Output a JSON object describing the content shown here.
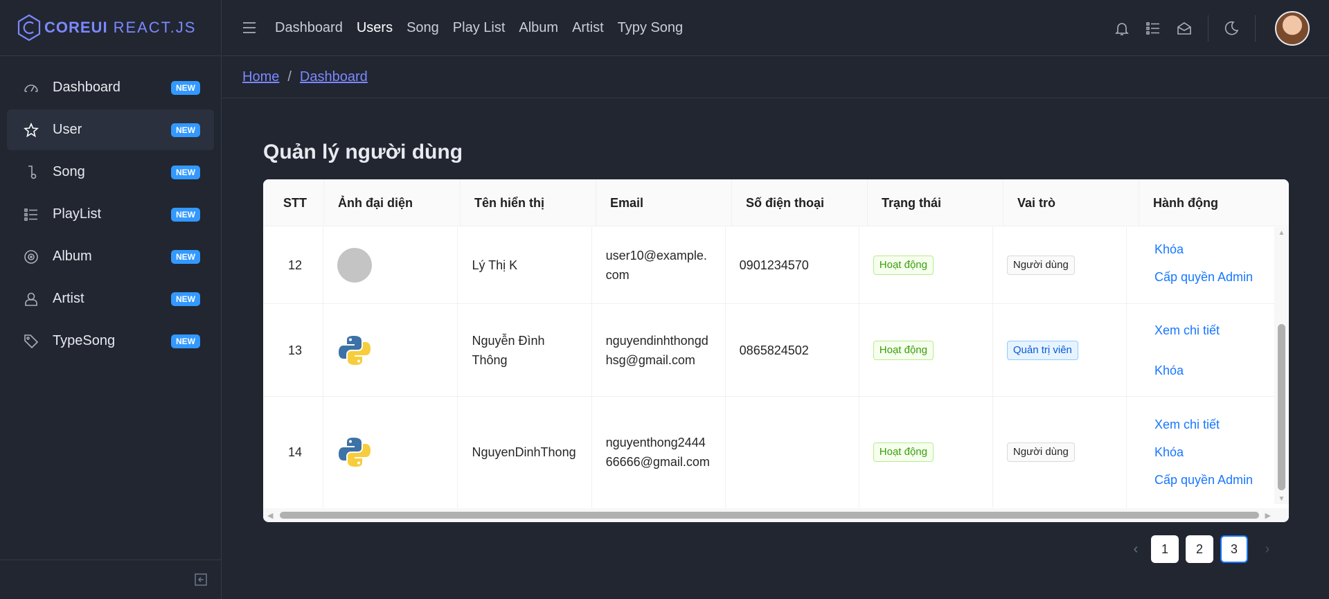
{
  "brand": {
    "core": "COREUI",
    "react": "REACT.JS"
  },
  "sidebar": {
    "items": [
      {
        "label": "Dashboard",
        "badge": "NEW",
        "icon": "speedometer-icon"
      },
      {
        "label": "User",
        "badge": "NEW",
        "icon": "star-icon"
      },
      {
        "label": "Song",
        "badge": "NEW",
        "icon": "music-note-icon"
      },
      {
        "label": "PlayList",
        "badge": "NEW",
        "icon": "list-icon"
      },
      {
        "label": "Album",
        "badge": "NEW",
        "icon": "disc-icon"
      },
      {
        "label": "Artist",
        "badge": "NEW",
        "icon": "user-icon"
      },
      {
        "label": "TypeSong",
        "badge": "NEW",
        "icon": "tag-icon"
      }
    ]
  },
  "header": {
    "nav": [
      "Dashboard",
      "Users",
      "Song",
      "Play List",
      "Album",
      "Artist",
      "Typy Song"
    ],
    "active": "Users"
  },
  "breadcrumb": {
    "home": "Home",
    "current": "Dashboard",
    "separator": "/"
  },
  "page": {
    "title": "Quản lý người dùng"
  },
  "table": {
    "columns": [
      "STT",
      "Ảnh đại diện",
      "Tên hiển thị",
      "Email",
      "Số điện thoại",
      "Trạng thái",
      "Vai trò",
      "Hành động"
    ],
    "rows": [
      {
        "stt": "12",
        "avatar": "placeholder",
        "name": "Lý Thị K",
        "email": "user10@example.com",
        "phone": "0901234570",
        "status": "Hoạt động",
        "role": "Người dùng",
        "actions": [
          "Khóa",
          "Cấp quyền Admin"
        ]
      },
      {
        "stt": "13",
        "avatar": "python-logo",
        "name": "Nguyễn Đình Thông",
        "email": "nguyendinhthongdhsg@gmail.com",
        "phone": "0865824502",
        "status": "Hoạt động",
        "role": "Quản trị viên",
        "actions": [
          "Xem chi tiết",
          "Khóa"
        ]
      },
      {
        "stt": "14",
        "avatar": "python-logo",
        "name": "NguyenDinhThong",
        "email": "nguyenthong244466666@gmail.com",
        "phone": "",
        "status": "Hoạt động",
        "role": "Người dùng",
        "actions": [
          "Xem chi tiết",
          "Khóa",
          "Cấp quyền Admin"
        ]
      }
    ]
  },
  "pagination": {
    "pages": [
      "1",
      "2",
      "3"
    ],
    "current": "3",
    "prev": "‹",
    "next": "›"
  },
  "colors": {
    "accent": "#7c89ff",
    "badge": "#3399ff",
    "link": "#1677ff",
    "background": "#212631"
  }
}
